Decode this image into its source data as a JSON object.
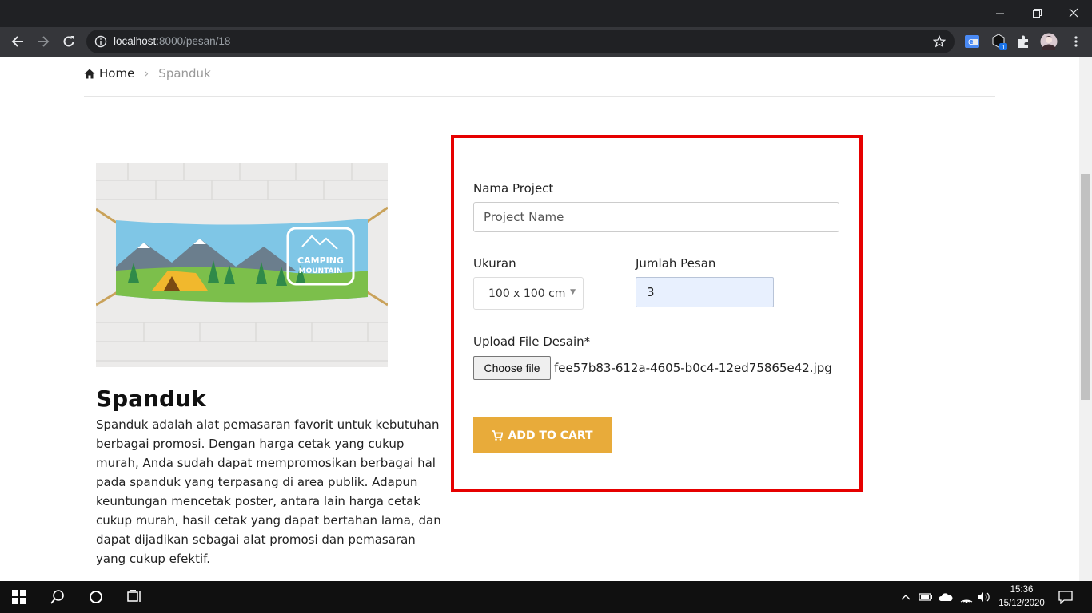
{
  "browser": {
    "url_host": "localhost",
    "url_path": ":8000/pesan/18"
  },
  "breadcrumb": {
    "home": "Home",
    "current": "Spanduk"
  },
  "product": {
    "title": "Spanduk",
    "image_text_line1": "CAMPING",
    "image_text_line2": "MOUNTAIN",
    "description": "Spanduk adalah alat pemasaran favorit untuk kebutuhan berbagai promosi. Dengan harga cetak yang cukup murah, Anda sudah dapat mempromosikan berbagai hal pada spanduk yang terpasang di area publik. Adapun keuntungan mencetak poster, antara lain harga cetak cukup murah, hasil cetak yang dapat bertahan lama, dan dapat dijadikan sebagai alat promosi dan pemasaran yang cukup efektif."
  },
  "form": {
    "project_label": "Nama Project",
    "project_placeholder": "Project Name",
    "size_label": "Ukuran",
    "size_value": "100 x 100 cm",
    "qty_label": "Jumlah Pesan",
    "qty_value": "3",
    "upload_label": "Upload File Desain*",
    "choose_file": "Choose file",
    "file_name": "fee57b83-612a-4605-b0c4-12ed75865e42.jpg",
    "submit_label": "ADD TO CART",
    "highlight_color": "#e60000",
    "button_color": "#e8ab3a"
  },
  "taskbar": {
    "time": "15:36",
    "date": "15/12/2020"
  }
}
